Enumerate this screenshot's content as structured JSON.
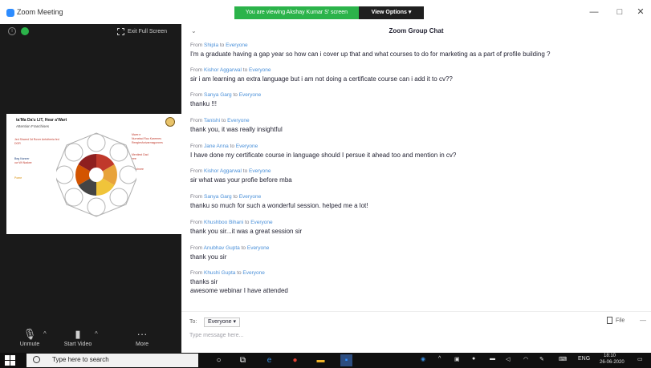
{
  "titlebar": {
    "app_title": "Zoom Meeting",
    "viewing_banner": "You are viewing Akshay Kumar S' screen",
    "view_options": "View Options ▾",
    "minimize": "—",
    "restore": "□",
    "close": "✕"
  },
  "video": {
    "fullscreen_label": "Exit Full Screen",
    "slide": {
      "title": "ta'Ma Da'u LIT, Hear a'Wart",
      "subtitle": "Attention Franchises",
      "left_notes": [
        "Jed Shared 3d Rover Anfotheria fed",
        "DOR",
        "Beg Kanner",
        "ow Wt Nadwe",
        "Pome"
      ],
      "right_notes": [
        "Mwer.e",
        "Nurnetad Rau Kareeres",
        "Reegiesfurivarmagonnes",
        "Mentiest Dad",
        "eee",
        "Purchnee"
      ]
    },
    "controls": {
      "unmute": "Unmute",
      "start_video": "Start Video",
      "more": "More"
    }
  },
  "chat": {
    "title": "Zoom Group Chat",
    "collapse_icon": "⌄",
    "messages": [
      {
        "from": "Shipla",
        "to": "Everyone",
        "text": "I'm a graduate having a gap year so how can i cover up that and what courses to do for marketing as a part of profile building ?"
      },
      {
        "from": "Kishor Aggarwal",
        "to": "Everyone",
        "text": "sir i am learning an extra language but i am not doing a certificate course can i add it to cv??"
      },
      {
        "from": "Sanya Garg",
        "to": "Everyone",
        "text": "thanku !!!"
      },
      {
        "from": "Tanishi",
        "to": "Everyone",
        "text": "thank you, it was really insightful"
      },
      {
        "from": "Jane Anna",
        "to": "Everyone",
        "text": "I have done my certificate course in language should I persue it ahead too and mention in cv?"
      },
      {
        "from": "Kishor Aggarwal",
        "to": "Everyone",
        "text": "sir what was your profie before mba"
      },
      {
        "from": "Sanya Garg",
        "to": "Everyone",
        "text": "thanku so much for such a wonderful session. helped me a lot!"
      },
      {
        "from": "Khushboo Bihani",
        "to": "Everyone",
        "text": "thank you sir...it was a great session sir"
      },
      {
        "from": "Anubhav Gupta",
        "to": "Everyone",
        "text": "thank you sir"
      },
      {
        "from": "Khushi Gupta",
        "to": "Everyone",
        "text": "thanks sir",
        "text2": "awesome webinar I have attended"
      }
    ],
    "from_prefix": "From",
    "to_word": "to",
    "to_label": "To:",
    "to_value": "Everyone ▾",
    "file_label": "File",
    "more_icon": "—",
    "input_placeholder": "Type message here..."
  },
  "taskbar": {
    "search_placeholder": "Type here to search",
    "tray_lang": "ENG",
    "time": "18:10",
    "date": "26-06-2020"
  },
  "colors": {
    "banner_green": "#2bb34a",
    "zoom_blue": "#2d8cff",
    "name_blue": "#4a90d9"
  }
}
